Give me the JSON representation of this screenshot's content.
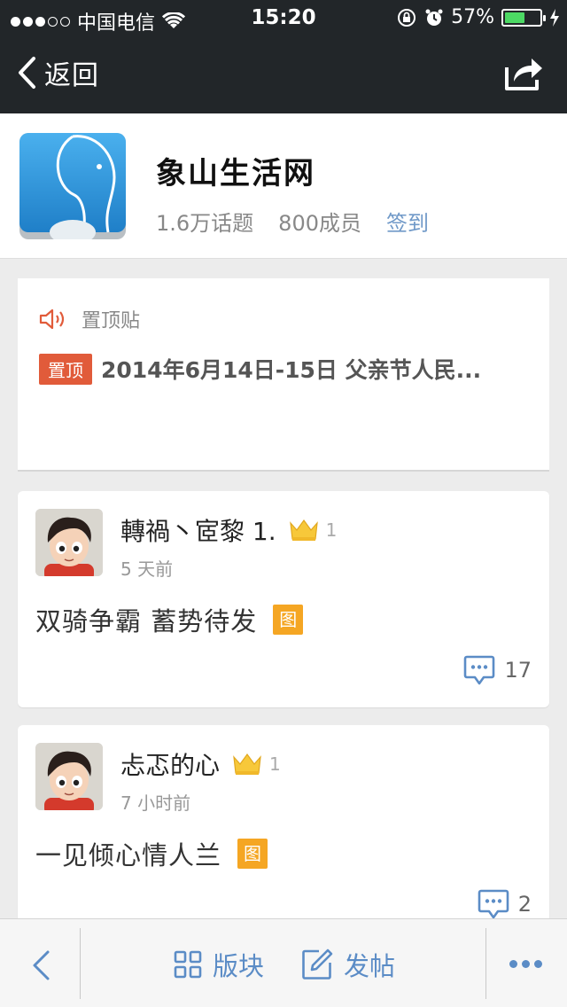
{
  "status_bar": {
    "carrier": "中国电信",
    "time": "15:20",
    "battery": "57%",
    "battery_level": 0.57,
    "signal_bars_filled": 3,
    "signal_bars_total": 5
  },
  "nav": {
    "back_label": "返回",
    "share_icon": "share-icon"
  },
  "forum": {
    "name": "象山生活网",
    "topics": "1.6万话题",
    "members": "800成员",
    "checkin_label": "签到"
  },
  "pinned": {
    "section_title": "置顶贴",
    "tag": "置顶",
    "title": "2014年6月14日-15日 父亲节人民..."
  },
  "posts": [
    {
      "author": "轉禍丶宧黎 1.",
      "level": "1",
      "time": "5 天前",
      "text": "双骑争霸 蓄势待发",
      "image_tag": "图",
      "comments": "17"
    },
    {
      "author": "忐忑的心",
      "level": "1",
      "time": "7 小时前",
      "text": "一见倾心情人兰",
      "image_tag": "图",
      "comments": "2"
    }
  ],
  "toolbar": {
    "boards_label": "版块",
    "post_label": "发帖"
  },
  "colors": {
    "nav_bg": "#222629",
    "accent_blue": "#5b8cc6",
    "pinned_tag": "#e15b3a",
    "image_tag": "#f5a623",
    "battery_green": "#4cd964"
  }
}
